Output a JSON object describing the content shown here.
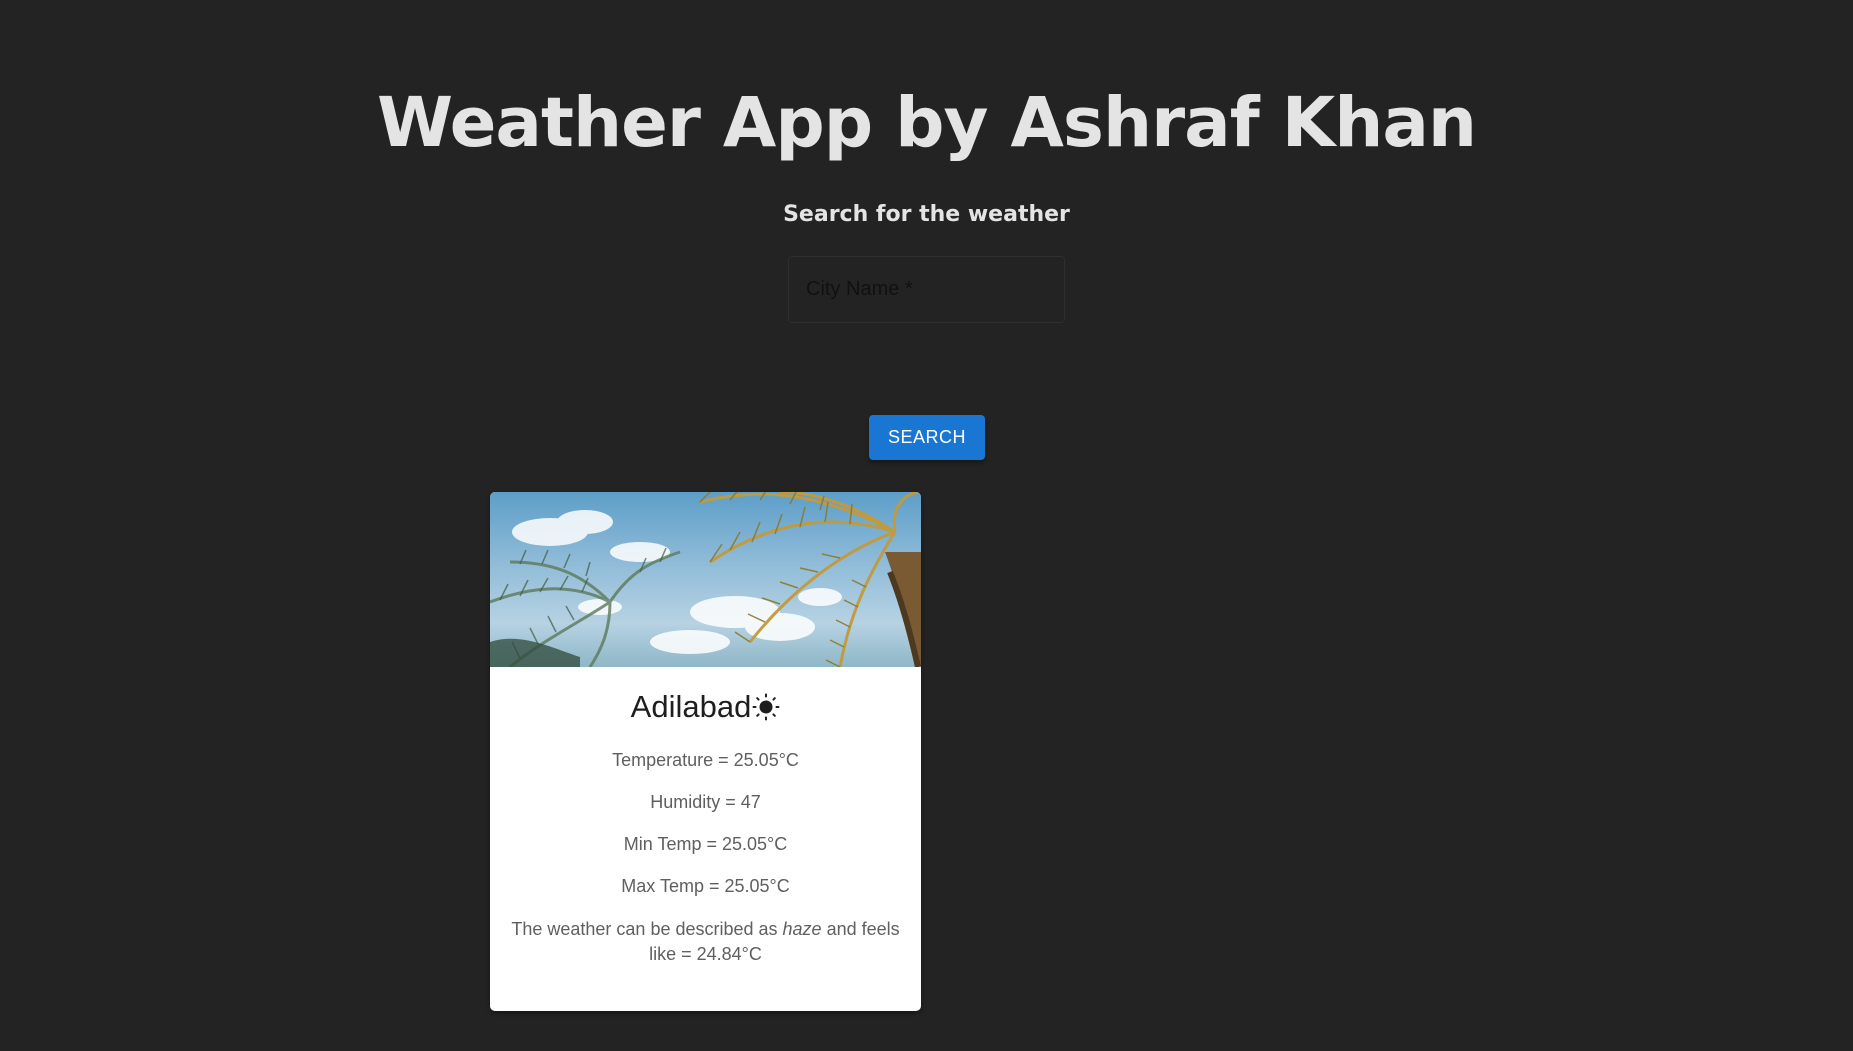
{
  "header": {
    "title": "Weather App by Ashraf Khan",
    "subtitle": "Search for the weather"
  },
  "search": {
    "placeholder": "City Name *",
    "value": "",
    "button_label": "SEARCH"
  },
  "card": {
    "city": "Adilabad",
    "weather_icon": "sun-icon",
    "temperature_label": "Temperature = 25.05°C",
    "humidity_label": "Humidity = 47",
    "min_temp_label": "Min Temp = 25.05°C",
    "max_temp_label": "Max Temp = 25.05°C",
    "description_prefix": "The weather can be described as ",
    "description": "haze",
    "description_suffix": " and feels like = 24.84°C"
  },
  "colors": {
    "background": "#232323",
    "accent": "#1976d2",
    "card": "#ffffff",
    "title_text": "#e4e4e4"
  }
}
